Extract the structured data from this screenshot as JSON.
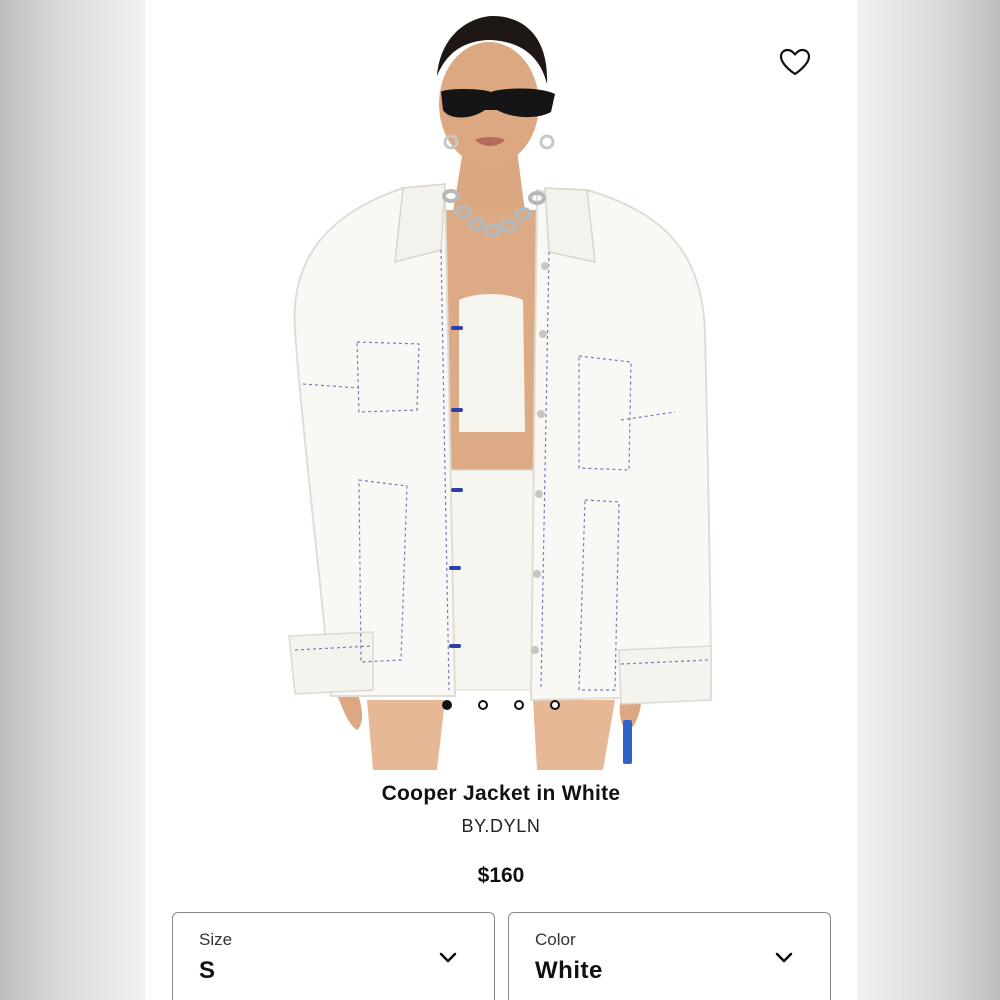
{
  "product": {
    "title": "Cooper Jacket in White",
    "brand": "BY.DYLN",
    "price": "$160"
  },
  "gallery": {
    "image_count": 4,
    "active_index": 0
  },
  "icons": {
    "wishlist": "heart-outline-icon",
    "dropdown": "chevron-down-icon"
  },
  "selectors": {
    "size": {
      "label": "Size",
      "value": "S"
    },
    "color": {
      "label": "Color",
      "value": "White"
    }
  },
  "colors": {
    "text": "#111111",
    "background": "#ffffff",
    "border": "#8a8a8a",
    "accent_stitch": "#2d3fa8"
  }
}
